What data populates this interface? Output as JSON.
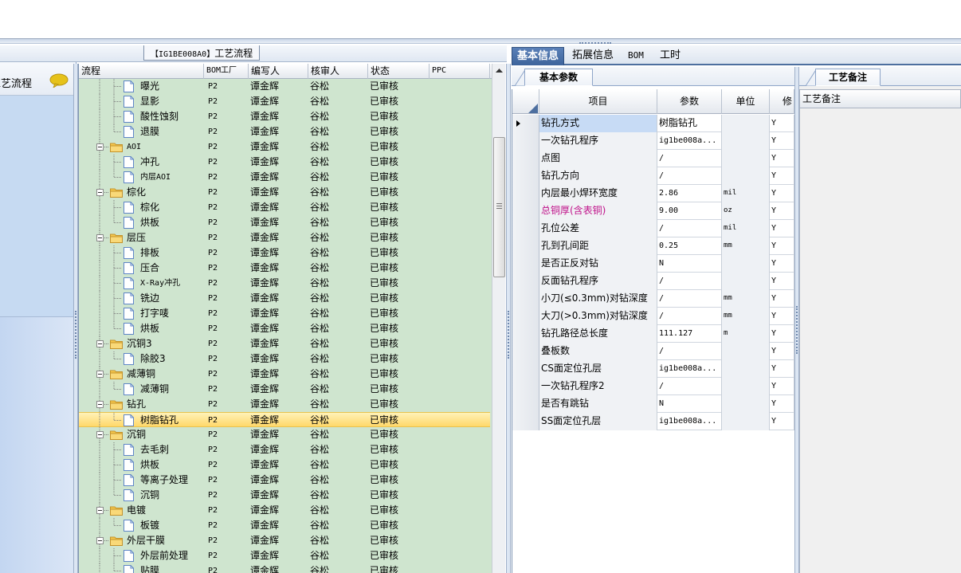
{
  "left_strip": {
    "label": "工艺流程"
  },
  "middle": {
    "title_code": "【IG1BE008A0】",
    "title_text": "工艺流程",
    "columns": [
      "流程",
      "BOM工厂",
      "编写人",
      "核审人",
      "状态",
      "PPC"
    ],
    "rows": [
      {
        "name": "曝光",
        "type": "leaf",
        "bom": "P2",
        "writer": "谭金辉",
        "auditor": "谷松",
        "status": "已审核"
      },
      {
        "name": "显影",
        "type": "leaf",
        "bom": "P2",
        "writer": "谭金辉",
        "auditor": "谷松",
        "status": "已审核"
      },
      {
        "name": "酸性蚀刻",
        "type": "leaf",
        "bom": "P2",
        "writer": "谭金辉",
        "auditor": "谷松",
        "status": "已审核"
      },
      {
        "name": "退膜",
        "type": "leaf",
        "bom": "P2",
        "writer": "谭金辉",
        "auditor": "谷松",
        "status": "已审核"
      },
      {
        "name": "AOI",
        "type": "folder",
        "bom": "P2",
        "writer": "谭金辉",
        "auditor": "谷松",
        "status": "已审核"
      },
      {
        "name": "冲孔",
        "type": "leaf",
        "bom": "P2",
        "writer": "谭金辉",
        "auditor": "谷松",
        "status": "已审核"
      },
      {
        "name": "内层AOI",
        "type": "leaf",
        "bom": "P2",
        "writer": "谭金辉",
        "auditor": "谷松",
        "status": "已审核"
      },
      {
        "name": "棕化",
        "type": "folder",
        "bom": "P2",
        "writer": "谭金辉",
        "auditor": "谷松",
        "status": "已审核"
      },
      {
        "name": "棕化",
        "type": "leaf",
        "bom": "P2",
        "writer": "谭金辉",
        "auditor": "谷松",
        "status": "已审核"
      },
      {
        "name": "烘板",
        "type": "leaf",
        "bom": "P2",
        "writer": "谭金辉",
        "auditor": "谷松",
        "status": "已审核"
      },
      {
        "name": "层压",
        "type": "folder",
        "bom": "P2",
        "writer": "谭金辉",
        "auditor": "谷松",
        "status": "已审核"
      },
      {
        "name": "排板",
        "type": "leaf",
        "bom": "P2",
        "writer": "谭金辉",
        "auditor": "谷松",
        "status": "已审核"
      },
      {
        "name": "压合",
        "type": "leaf",
        "bom": "P2",
        "writer": "谭金辉",
        "auditor": "谷松",
        "status": "已审核"
      },
      {
        "name": "X-Ray冲孔",
        "type": "leaf",
        "bom": "P2",
        "writer": "谭金辉",
        "auditor": "谷松",
        "status": "已审核"
      },
      {
        "name": "铣边",
        "type": "leaf",
        "bom": "P2",
        "writer": "谭金辉",
        "auditor": "谷松",
        "status": "已审核"
      },
      {
        "name": "打字唛",
        "type": "leaf",
        "bom": "P2",
        "writer": "谭金辉",
        "auditor": "谷松",
        "status": "已审核"
      },
      {
        "name": "烘板",
        "type": "leaf",
        "bom": "P2",
        "writer": "谭金辉",
        "auditor": "谷松",
        "status": "已审核"
      },
      {
        "name": "沉铜3",
        "type": "folder",
        "bom": "P2",
        "writer": "谭金辉",
        "auditor": "谷松",
        "status": "已审核"
      },
      {
        "name": "除胶3",
        "type": "leaf",
        "bom": "P2",
        "writer": "谭金辉",
        "auditor": "谷松",
        "status": "已审核"
      },
      {
        "name": "减薄铜",
        "type": "folder",
        "bom": "P2",
        "writer": "谭金辉",
        "auditor": "谷松",
        "status": "已审核"
      },
      {
        "name": "减薄铜",
        "type": "leaf",
        "bom": "P2",
        "writer": "谭金辉",
        "auditor": "谷松",
        "status": "已审核"
      },
      {
        "name": "钻孔",
        "type": "folder",
        "bom": "P2",
        "writer": "谭金辉",
        "auditor": "谷松",
        "status": "已审核"
      },
      {
        "name": "树脂钻孔",
        "type": "leaf",
        "selected": true,
        "bom": "P2",
        "writer": "谭金辉",
        "auditor": "谷松",
        "status": "已审核"
      },
      {
        "name": "沉铜",
        "type": "folder",
        "bom": "P2",
        "writer": "谭金辉",
        "auditor": "谷松",
        "status": "已审核"
      },
      {
        "name": "去毛刺",
        "type": "leaf",
        "bom": "P2",
        "writer": "谭金辉",
        "auditor": "谷松",
        "status": "已审核"
      },
      {
        "name": "烘板",
        "type": "leaf",
        "bom": "P2",
        "writer": "谭金辉",
        "auditor": "谷松",
        "status": "已审核"
      },
      {
        "name": "等离子处理",
        "type": "leaf",
        "bom": "P2",
        "writer": "谭金辉",
        "auditor": "谷松",
        "status": "已审核"
      },
      {
        "name": "沉铜",
        "type": "leaf",
        "bom": "P2",
        "writer": "谭金辉",
        "auditor": "谷松",
        "status": "已审核"
      },
      {
        "name": "电镀",
        "type": "folder",
        "bom": "P2",
        "writer": "谭金辉",
        "auditor": "谷松",
        "status": "已审核"
      },
      {
        "name": "板镀",
        "type": "leaf",
        "bom": "P2",
        "writer": "谭金辉",
        "auditor": "谷松",
        "status": "已审核"
      },
      {
        "name": "外层干膜",
        "type": "folder",
        "bom": "P2",
        "writer": "谭金辉",
        "auditor": "谷松",
        "status": "已审核"
      },
      {
        "name": "外层前处理",
        "type": "leaf",
        "bom": "P2",
        "writer": "谭金辉",
        "auditor": "谷松",
        "status": "已审核"
      },
      {
        "name": "贴膜",
        "type": "leaf",
        "bom": "P2",
        "writer": "谭金辉",
        "auditor": "谷松",
        "status": "已审核"
      }
    ]
  },
  "right": {
    "tabs": [
      "基本信息",
      "拓展信息",
      "BOM",
      "工时"
    ],
    "active_tab": "基本信息",
    "sub_tab": "基本参数",
    "param_columns": [
      "项目",
      "参数",
      "单位",
      "修"
    ],
    "params": [
      {
        "item": "钻孔方式",
        "value": "树脂钻孔",
        "unit": "",
        "mod": "Y",
        "current": true
      },
      {
        "item": "一次钻孔程序",
        "value": "ig1be008a...",
        "unit": "",
        "mod": "Y"
      },
      {
        "item": "点图",
        "value": "/",
        "unit": "",
        "mod": "Y"
      },
      {
        "item": "钻孔方向",
        "value": "/",
        "unit": "",
        "mod": "Y"
      },
      {
        "item": "内层最小焊环宽度",
        "value": "2.86",
        "unit": "mil",
        "mod": "Y"
      },
      {
        "item": "总铜厚(含表铜)",
        "value": "9.00",
        "unit": "oz",
        "mod": "Y",
        "warn": true
      },
      {
        "item": "孔位公差",
        "value": "/",
        "unit": "mil",
        "mod": "Y"
      },
      {
        "item": "孔到孔间距",
        "value": "0.25",
        "unit": "mm",
        "mod": "Y"
      },
      {
        "item": "是否正反对钻",
        "value": "N",
        "unit": "",
        "mod": "Y"
      },
      {
        "item": "反面钻孔程序",
        "value": "/",
        "unit": "",
        "mod": "Y"
      },
      {
        "item": "小刀(≤0.3mm)对钻深度",
        "value": "/",
        "unit": "mm",
        "mod": "Y"
      },
      {
        "item": "大刀(>0.3mm)对钻深度",
        "value": "/",
        "unit": "mm",
        "mod": "Y"
      },
      {
        "item": "钻孔路径总长度",
        "value": "111.127",
        "unit": "m",
        "mod": "Y"
      },
      {
        "item": "叠板数",
        "value": "/",
        "unit": "",
        "mod": "Y"
      },
      {
        "item": "CS面定位孔层",
        "value": "ig1be008a...",
        "unit": "",
        "mod": "Y"
      },
      {
        "item": "一次钻孔程序2",
        "value": "/",
        "unit": "",
        "mod": "Y"
      },
      {
        "item": "是否有跳钻",
        "value": "N",
        "unit": "",
        "mod": "Y"
      },
      {
        "item": "SS面定位孔层",
        "value": "ig1be008a...",
        "unit": "",
        "mod": "Y"
      }
    ],
    "remark_tab": "工艺备注",
    "remark_header": "工艺备注"
  },
  "icons": {
    "chat": "speech-bubble-icon",
    "folder": "folder-icon",
    "document": "document-icon"
  },
  "colors": {
    "tree_bg": "#cfe5cf",
    "selected_row": "#ffd86a",
    "active_tab": "#4a70a8",
    "warn_text": "#c0138a",
    "chat_icon": "#e6c21a"
  }
}
